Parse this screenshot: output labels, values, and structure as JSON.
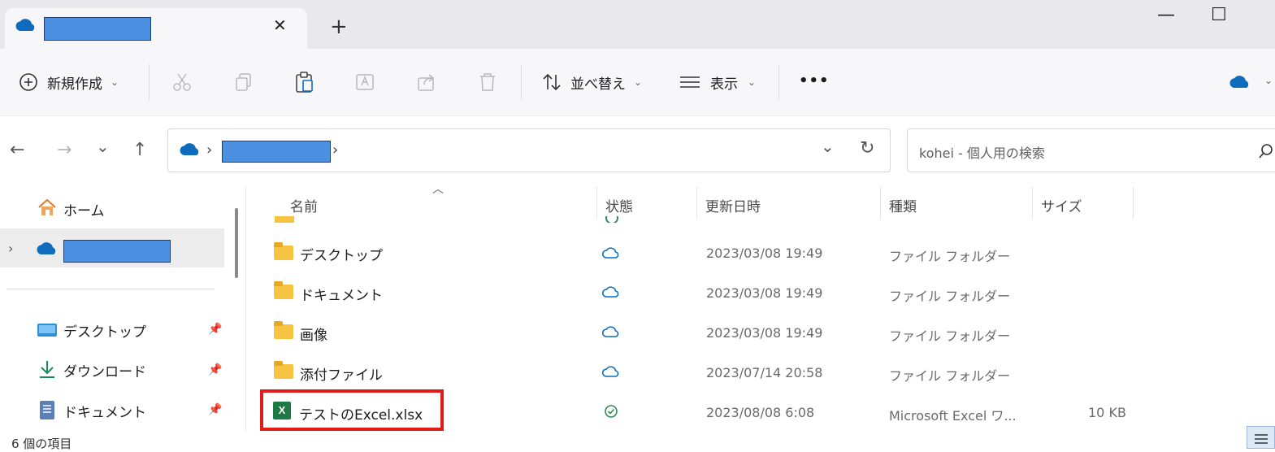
{
  "tab": {
    "title_redacted": "",
    "new_tab_glyph": "+",
    "close_glyph": "✕"
  },
  "window": {
    "minimize_glyph": "—",
    "maximize_glyph": "☐"
  },
  "commands": {
    "new_label": "新規作成",
    "sort_label": "並べ替え",
    "view_label": "表示",
    "more_glyph": "•••"
  },
  "nav": {
    "back_glyph": "←",
    "forward_glyph": "→",
    "recent_glyph": "⌄",
    "up_glyph": "↑"
  },
  "address": {
    "separator": "›",
    "refresh_glyph": "↻",
    "dropdown_glyph": "⌄"
  },
  "search": {
    "placeholder": "kohei - 個人用の検索",
    "icon_glyph": "⌕"
  },
  "sidebar": {
    "home_label": "ホーム",
    "quick": [
      {
        "label": "デスクトップ"
      },
      {
        "label": "ダウンロード"
      },
      {
        "label": "ドキュメント"
      }
    ]
  },
  "columns": {
    "name": "名前",
    "status": "状態",
    "modified": "更新日時",
    "type": "種類",
    "size": "サイズ"
  },
  "rows": [
    {
      "name": "デスクトップ",
      "date": "2023/03/08 19:49",
      "type": "ファイル フォルダー",
      "size": "",
      "status": "cloud"
    },
    {
      "name": "ドキュメント",
      "date": "2023/03/08 19:49",
      "type": "ファイル フォルダー",
      "size": "",
      "status": "cloud"
    },
    {
      "name": "画像",
      "date": "2023/03/08 19:49",
      "type": "ファイル フォルダー",
      "size": "",
      "status": "cloud"
    },
    {
      "name": "添付ファイル",
      "date": "2023/07/14 20:58",
      "type": "ファイル フォルダー",
      "size": "",
      "status": "cloud"
    },
    {
      "name": "テストのExcel.xlsx",
      "date": "2023/08/08 6:08",
      "type": "Microsoft Excel ワ...",
      "size": "10 KB",
      "status": "synced"
    }
  ],
  "status_bar": {
    "item_count": "6 個の項目"
  },
  "colors": {
    "accent": "#0f6cbd",
    "highlight": "#e21b1b",
    "folder": "#f6c342",
    "excel": "#1d7a45"
  }
}
